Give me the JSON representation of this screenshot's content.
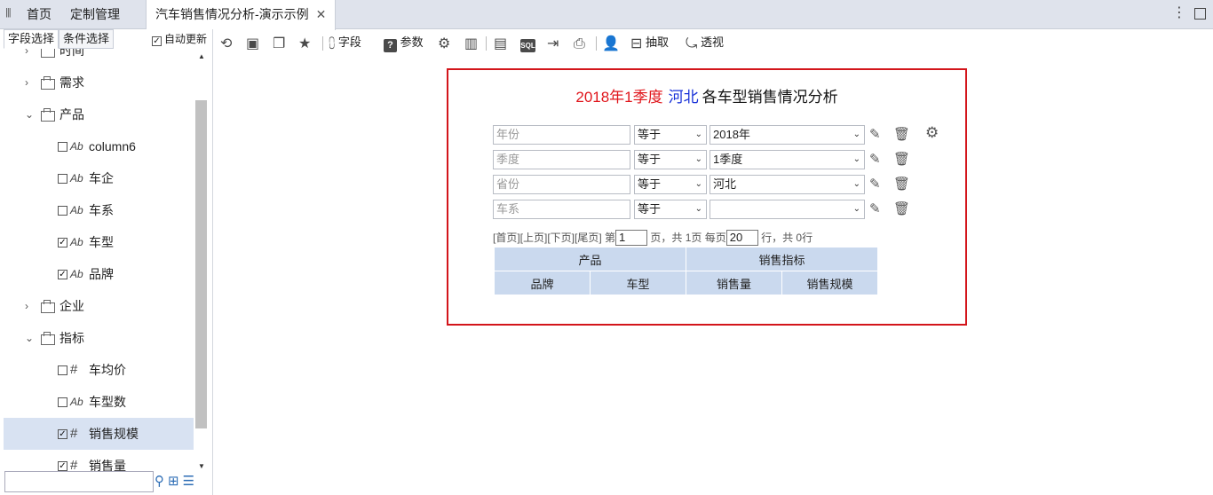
{
  "tabbar": {
    "home": "首页",
    "custom_mgmt": "定制管理",
    "active_tab": "汽车销售情况分析-演示示例",
    "close": "✕"
  },
  "left_panel": {
    "tab_fields": "字段选择",
    "tab_conditions": "条件选择",
    "auto_update_label": "自动更新",
    "auto_update_checked": true,
    "tree": [
      {
        "label": "时间",
        "kind": "folder",
        "expanded": false
      },
      {
        "label": "需求",
        "kind": "folder",
        "expanded": false
      },
      {
        "label": "产品",
        "kind": "folder",
        "expanded": true
      },
      {
        "label": "column6",
        "kind": "text",
        "type_icon": "Ab",
        "checked": false
      },
      {
        "label": "车企",
        "kind": "text",
        "type_icon": "Ab",
        "checked": false
      },
      {
        "label": "车系",
        "kind": "text",
        "type_icon": "Ab",
        "checked": false
      },
      {
        "label": "车型",
        "kind": "text",
        "type_icon": "Ab",
        "checked": true
      },
      {
        "label": "品牌",
        "kind": "text",
        "type_icon": "Ab",
        "checked": true
      },
      {
        "label": "企业",
        "kind": "folder",
        "expanded": false
      },
      {
        "label": "指标",
        "kind": "folder",
        "expanded": true
      },
      {
        "label": "车均价",
        "kind": "number",
        "type_icon": "#",
        "checked": false
      },
      {
        "label": "车型数",
        "kind": "text",
        "type_icon": "Ab",
        "checked": false
      },
      {
        "label": "销售规模",
        "kind": "number",
        "type_icon": "#",
        "checked": true,
        "selected": true
      },
      {
        "label": "销售量",
        "kind": "number",
        "type_icon": "#",
        "checked": true
      }
    ],
    "search_value": ""
  },
  "toolbar": {
    "fields": "字段",
    "params": "参数",
    "extract": "抽取",
    "pivot": "透视",
    "sql": "SQL",
    "param_icon_glyph": "?"
  },
  "report": {
    "title_year_quarter": "2018年1季度",
    "title_province": "河北",
    "title_rest": "各车型销售情况分析",
    "filters": [
      {
        "field_placeholder": "年份",
        "op": "等于",
        "value": "2018年"
      },
      {
        "field_placeholder": "季度",
        "op": "等于",
        "value": "1季度"
      },
      {
        "field_placeholder": "省份",
        "op": "等于",
        "value": "河北"
      },
      {
        "field_placeholder": "车系",
        "op": "等于",
        "value": ""
      }
    ],
    "pager": {
      "first": "[首页]",
      "prev": "[上页]",
      "next": "[下页]",
      "last": "[尾页]",
      "page_prefix": "第",
      "page_value": "1",
      "page_suffix": "页，共 1页 每页",
      "size_value": "20",
      "size_suffix": "行，共 0行"
    },
    "table": {
      "group_headers": [
        "产品",
        "销售指标"
      ],
      "columns": [
        "品牌",
        "车型",
        "销售量",
        "销售规模"
      ]
    }
  }
}
